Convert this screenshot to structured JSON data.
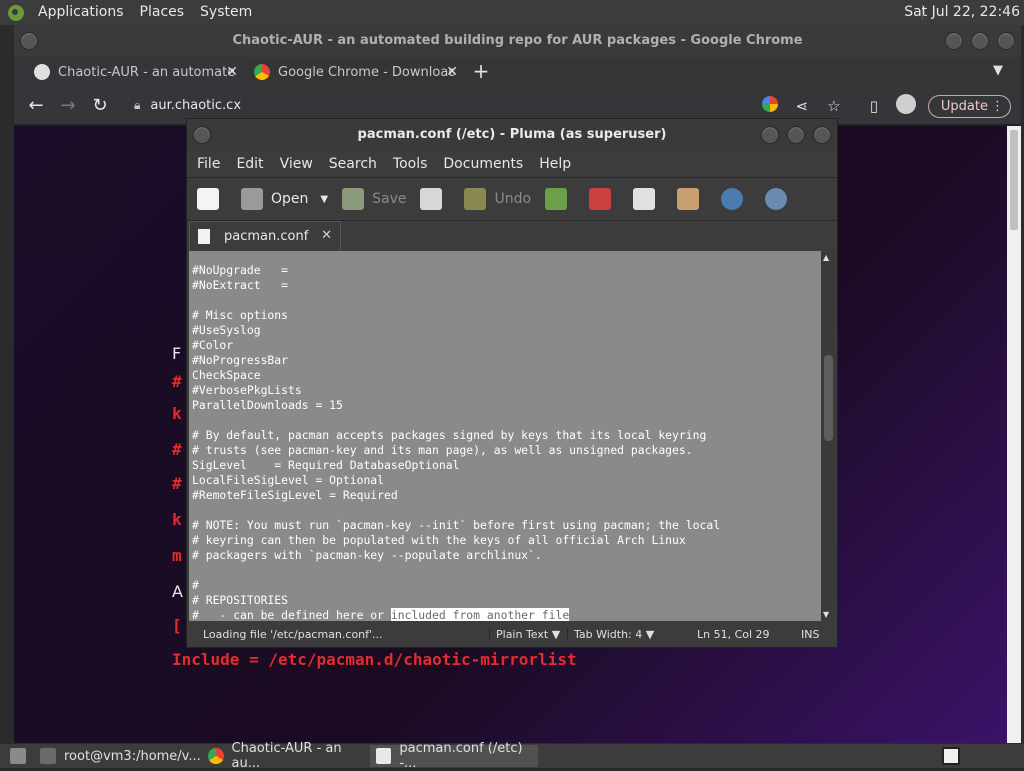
{
  "top_panel": {
    "menus": [
      "Applications",
      "Places",
      "System"
    ],
    "clock": "Sat Jul 22, 22:46"
  },
  "chrome": {
    "window_title": "Chaotic-AUR - an automated building repo for AUR packages - Google Chrome",
    "tabs": [
      {
        "label": "Chaotic-AUR - an automated",
        "icon": "globe-icon",
        "active": true
      },
      {
        "label": "Google Chrome - Download th",
        "icon": "chrome-icon",
        "active": false
      }
    ],
    "new_tab": "+",
    "url": "aur.chaotic.cx",
    "update_label": "Update",
    "page_lines": [
      {
        "text": "F",
        "color": "white"
      },
      {
        "text": "#",
        "color": "red"
      },
      {
        "text": "k",
        "color": "red"
      },
      {
        "text": "#",
        "color": "red"
      },
      {
        "text": "#",
        "color": "red"
      },
      {
        "text": "k",
        "color": "red"
      },
      {
        "text": "m",
        "color": "red"
      },
      {
        "text": "A",
        "color": "white"
      },
      {
        "text": "[",
        "color": "red"
      },
      {
        "text": "Include = /etc/pacman.d/chaotic-mirrorlist",
        "color": "red"
      }
    ]
  },
  "pluma": {
    "window_title": "pacman.conf (/etc) - Pluma (as superuser)",
    "menu": [
      "File",
      "Edit",
      "View",
      "Search",
      "Tools",
      "Documents",
      "Help"
    ],
    "toolbar": {
      "open_label": "Open",
      "save_label": "Save",
      "undo_label": "Undo"
    },
    "tab_label": "pacman.conf",
    "lines": [
      "#NoUpgrade   =",
      "#NoExtract   =",
      "",
      "# Misc options",
      "#UseSyslog",
      "#Color",
      "#NoProgressBar",
      "CheckSpace",
      "#VerbosePkgLists",
      "ParallelDownloads = 15",
      "",
      "# By default, pacman accepts packages signed by keys that its local keyring",
      "# trusts (see pacman-key and its man page), as well as unsigned packages.",
      "SigLevel    = Required DatabaseOptional",
      "LocalFileSigLevel = Optional",
      "#RemoteFileSigLevel = Required",
      "",
      "# NOTE: You must run `pacman-key --init` before first using pacman; the local",
      "# keyring can then be populated with the keys of all official Arch Linux",
      "# packagers with `pacman-key --populate archlinux`.",
      "",
      "#",
      "# REPOSITORIES"
    ],
    "last_line_plain": "#   - can be defined here or ",
    "last_line_selected": "included from another file",
    "status": {
      "message": "Loading file '/etc/pacman.conf'...",
      "language": "Plain Text",
      "tab_width": "Tab Width:  4",
      "position": "Ln 51, Col 29",
      "mode": "INS"
    }
  },
  "taskbar": {
    "tasks": [
      {
        "label": "root@vm3:/home/v...",
        "icon": "terminal-icon"
      },
      {
        "label": "Chaotic-AUR - an au...",
        "icon": "chrome-icon"
      },
      {
        "label": "pacman.conf (/etc) -...",
        "icon": "pluma-icon"
      }
    ]
  }
}
